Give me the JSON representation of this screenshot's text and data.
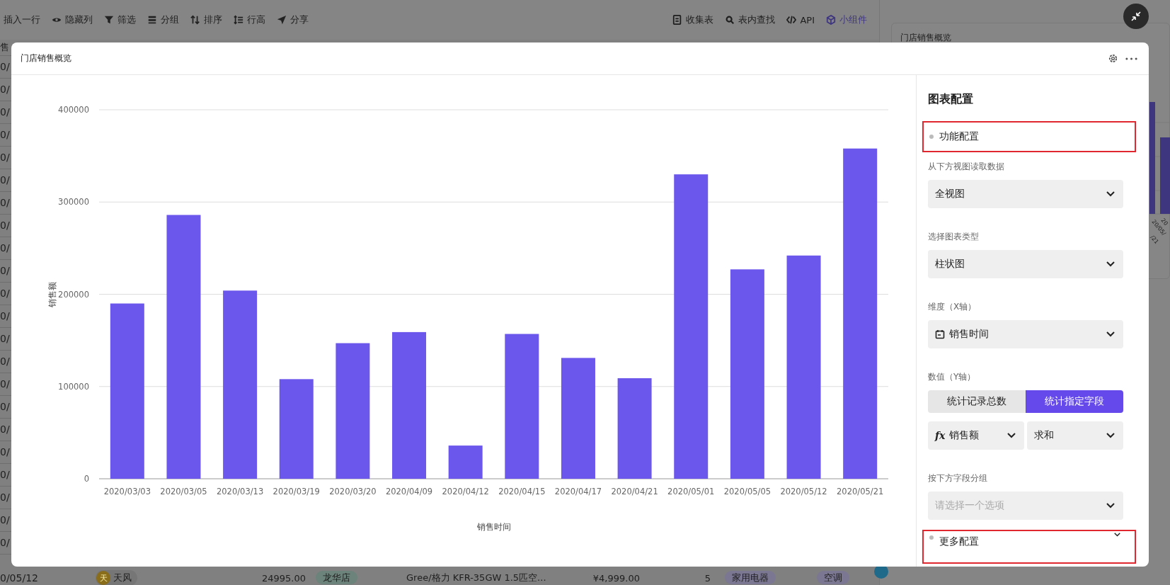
{
  "toolbar": {
    "left": [
      {
        "label": "插入一行"
      },
      {
        "label": "隐藏列"
      },
      {
        "label": "筛选"
      },
      {
        "label": "分组"
      },
      {
        "label": "排序"
      },
      {
        "label": "行高"
      },
      {
        "label": "分享"
      }
    ],
    "right": [
      {
        "label": "收集表",
        "selected": false
      },
      {
        "label": "表内查找",
        "selected": false
      },
      {
        "label": "API",
        "selected": false
      },
      {
        "label": "小组件",
        "selected": true
      }
    ]
  },
  "table": {
    "header_cell": "售",
    "row_cells": [
      "0/",
      "0/",
      "0/",
      "0/",
      "0/",
      "0/",
      "0/",
      "0/",
      "0/",
      "0/",
      "0/",
      "0/",
      "0/",
      "0/",
      "0/",
      "0/",
      "0/",
      "0/",
      "0/",
      "0/",
      "0/",
      "0/"
    ],
    "last_row": {
      "date": "0/05/12",
      "avatar": "天",
      "person": "天风",
      "amount": "24995.00",
      "store": "龙华店",
      "product": "Gree/格力 KFR-35GW 1.5匹空...",
      "price": "¥4,999.00",
      "qty": "5",
      "category": "家用电器",
      "subcategory": "空调"
    }
  },
  "background_widget": {
    "title": "门店销售概览",
    "labels": [
      "20",
      "20/05/",
      "/21"
    ]
  },
  "modal": {
    "title": "门店销售概览",
    "chart_data": {
      "type": "bar",
      "xlabel": "销售时间",
      "ylabel": "销售额",
      "grid": true,
      "categories": [
        "2020/03/03",
        "2020/03/05",
        "2020/03/13",
        "2020/03/19",
        "2020/03/20",
        "2020/04/09",
        "2020/04/12",
        "2020/04/15",
        "2020/04/17",
        "2020/04/21",
        "2020/05/01",
        "2020/05/05",
        "2020/05/12",
        "2020/05/21"
      ],
      "values": [
        190000,
        286000,
        204000,
        108000,
        147000,
        159000,
        36000,
        157000,
        131000,
        109000,
        330000,
        227000,
        242000,
        358000
      ],
      "ylim": [
        0,
        400000
      ],
      "yticks": [
        0,
        100000,
        200000,
        300000,
        400000
      ]
    },
    "config": {
      "title": "图表配置",
      "section": "功能配置",
      "source_label": "从下方视图读取数据",
      "source_value": "全视图",
      "type_label": "选择图表类型",
      "type_value": "柱状图",
      "x_label": "维度（X轴）",
      "x_value": "销售时间",
      "y_label": "数值（Y轴）",
      "y_modes": [
        {
          "label": "统计记录总数",
          "selected": false
        },
        {
          "label": "统计指定字段",
          "selected": true
        }
      ],
      "field_icon": "fx",
      "field_value": "销售额",
      "agg_value": "求和",
      "group_label": "按下方字段分组",
      "group_placeholder": "请选择一个选项",
      "more_section": "更多配置"
    }
  }
}
